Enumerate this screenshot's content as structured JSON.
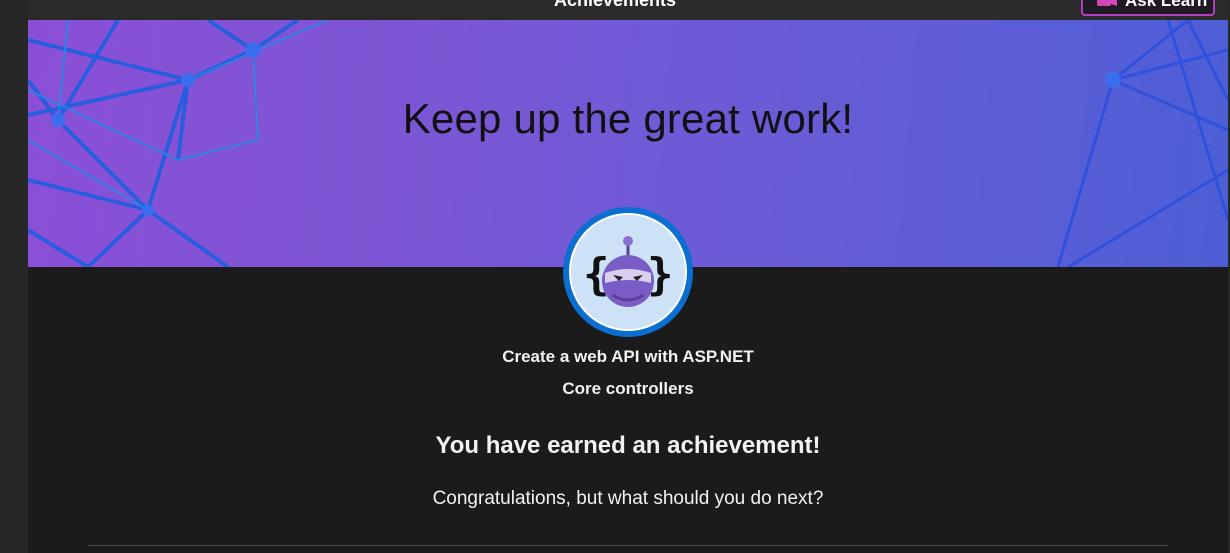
{
  "header": {
    "title": "Achievements",
    "ask_button_label": "Ask Learn"
  },
  "banner": {
    "headline": "Keep up the great work!"
  },
  "badge": {
    "icon": "robot-mascot-icon"
  },
  "achievement": {
    "module_title_line1": "Create a web API with ASP.NET",
    "module_title_line2": "Core controllers",
    "earned_text": "You have earned an achievement!",
    "next_prompt": "Congratulations, but what should you do next?"
  },
  "colors": {
    "banner_start": "#8b4fd6",
    "banner_end": "#4d5fd6",
    "badge_ring": "#0b6fd1",
    "ask_border": "#b43ec2"
  }
}
